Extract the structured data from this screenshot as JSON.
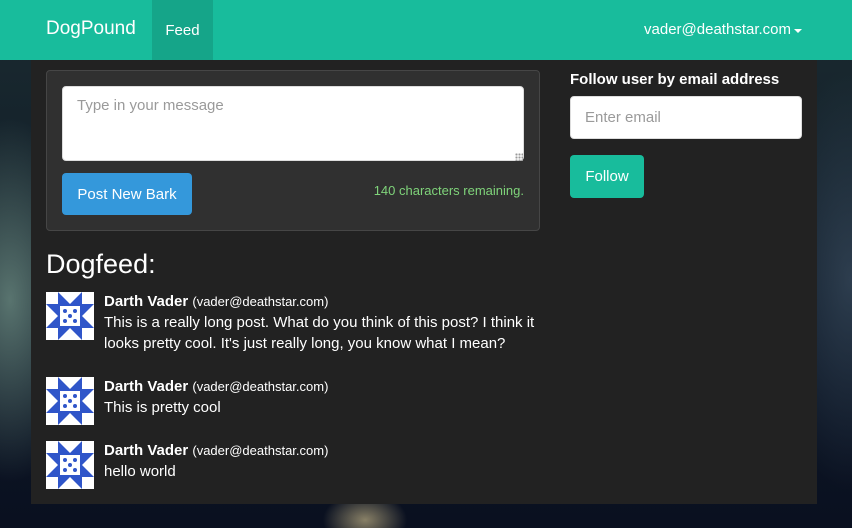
{
  "navbar": {
    "brand": "DogPound",
    "feed_tab": "Feed",
    "user_email": "vader@deathstar.com",
    "color": "#18bc9c"
  },
  "compose": {
    "placeholder": "Type in your message",
    "post_button": "Post New Bark",
    "chars_remaining": "140 characters remaining."
  },
  "follow": {
    "label": "Follow user by email address",
    "placeholder": "Enter email",
    "button": "Follow"
  },
  "feed": {
    "title": "Dogfeed:",
    "posts": [
      {
        "author": "Darth Vader",
        "email": "(vader@deathstar.com)",
        "text": "This is a really long post. What do you think of this post? I think it looks pretty cool. It's just really long, you know what I mean?",
        "avatar_icon": "identicon-avatar"
      },
      {
        "author": "Darth Vader",
        "email": "(vader@deathstar.com)",
        "text": "This is pretty cool",
        "avatar_icon": "identicon-avatar"
      },
      {
        "author": "Darth Vader",
        "email": "(vader@deathstar.com)",
        "text": "hello world",
        "avatar_icon": "identicon-avatar"
      }
    ]
  },
  "colors": {
    "accent": "#18bc9c",
    "primary_button": "#3498db",
    "success_text": "#7fd37a",
    "avatar_blue": "#2f55c9"
  }
}
